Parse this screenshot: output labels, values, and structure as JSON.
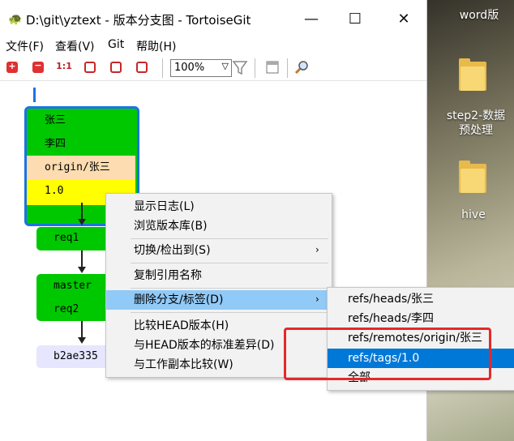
{
  "window": {
    "title": "D:\\git\\yztext - 版本分支图 - TortoiseGit",
    "minimize_glyph": "—",
    "maximize_glyph": "☐",
    "close_glyph": "✕"
  },
  "menubar": {
    "items": [
      "文件(F)",
      "查看(V)",
      "Git",
      "帮助(H)"
    ]
  },
  "toolbar": {
    "zoom_value": "100%",
    "buttons": [
      "zoom-in",
      "zoom-out",
      "1:1",
      "fit-window",
      "fit-width",
      "fit-height"
    ],
    "one_to_one_label": "1:1"
  },
  "graph": {
    "main_node": {
      "labels": [
        "张三",
        "李四",
        "origin/张三",
        "1.0"
      ]
    },
    "req1_label": "req1",
    "master_node": {
      "labels": [
        "master",
        "req2"
      ]
    },
    "commit_hash": "b2ae335"
  },
  "context_menu": {
    "items": [
      "显示日志(L)",
      "浏览版本库(B)",
      "切换/检出到(S)",
      "复制引用名称",
      "删除分支/标签(D)",
      "比较HEAD版本(H)",
      "与HEAD版本的标准差异(D)",
      "与工作副本比较(W)"
    ]
  },
  "submenu": {
    "items": [
      "refs/heads/张三",
      "refs/heads/李四",
      "refs/remotes/origin/张三",
      "refs/tags/1.0",
      "全部"
    ]
  },
  "desktop": {
    "labels": [
      "word版",
      "step2-数据",
      "预处理",
      "hive"
    ]
  },
  "colors": {
    "branch_green": "#00c800",
    "remote_tan": "#fcdcb0",
    "tag_yellow": "#ffff00",
    "selected_border": "#1a73e8",
    "menu_highlight": "#91c9f7",
    "submenu_selected": "#0078d7",
    "annotation_red": "#e52828"
  }
}
